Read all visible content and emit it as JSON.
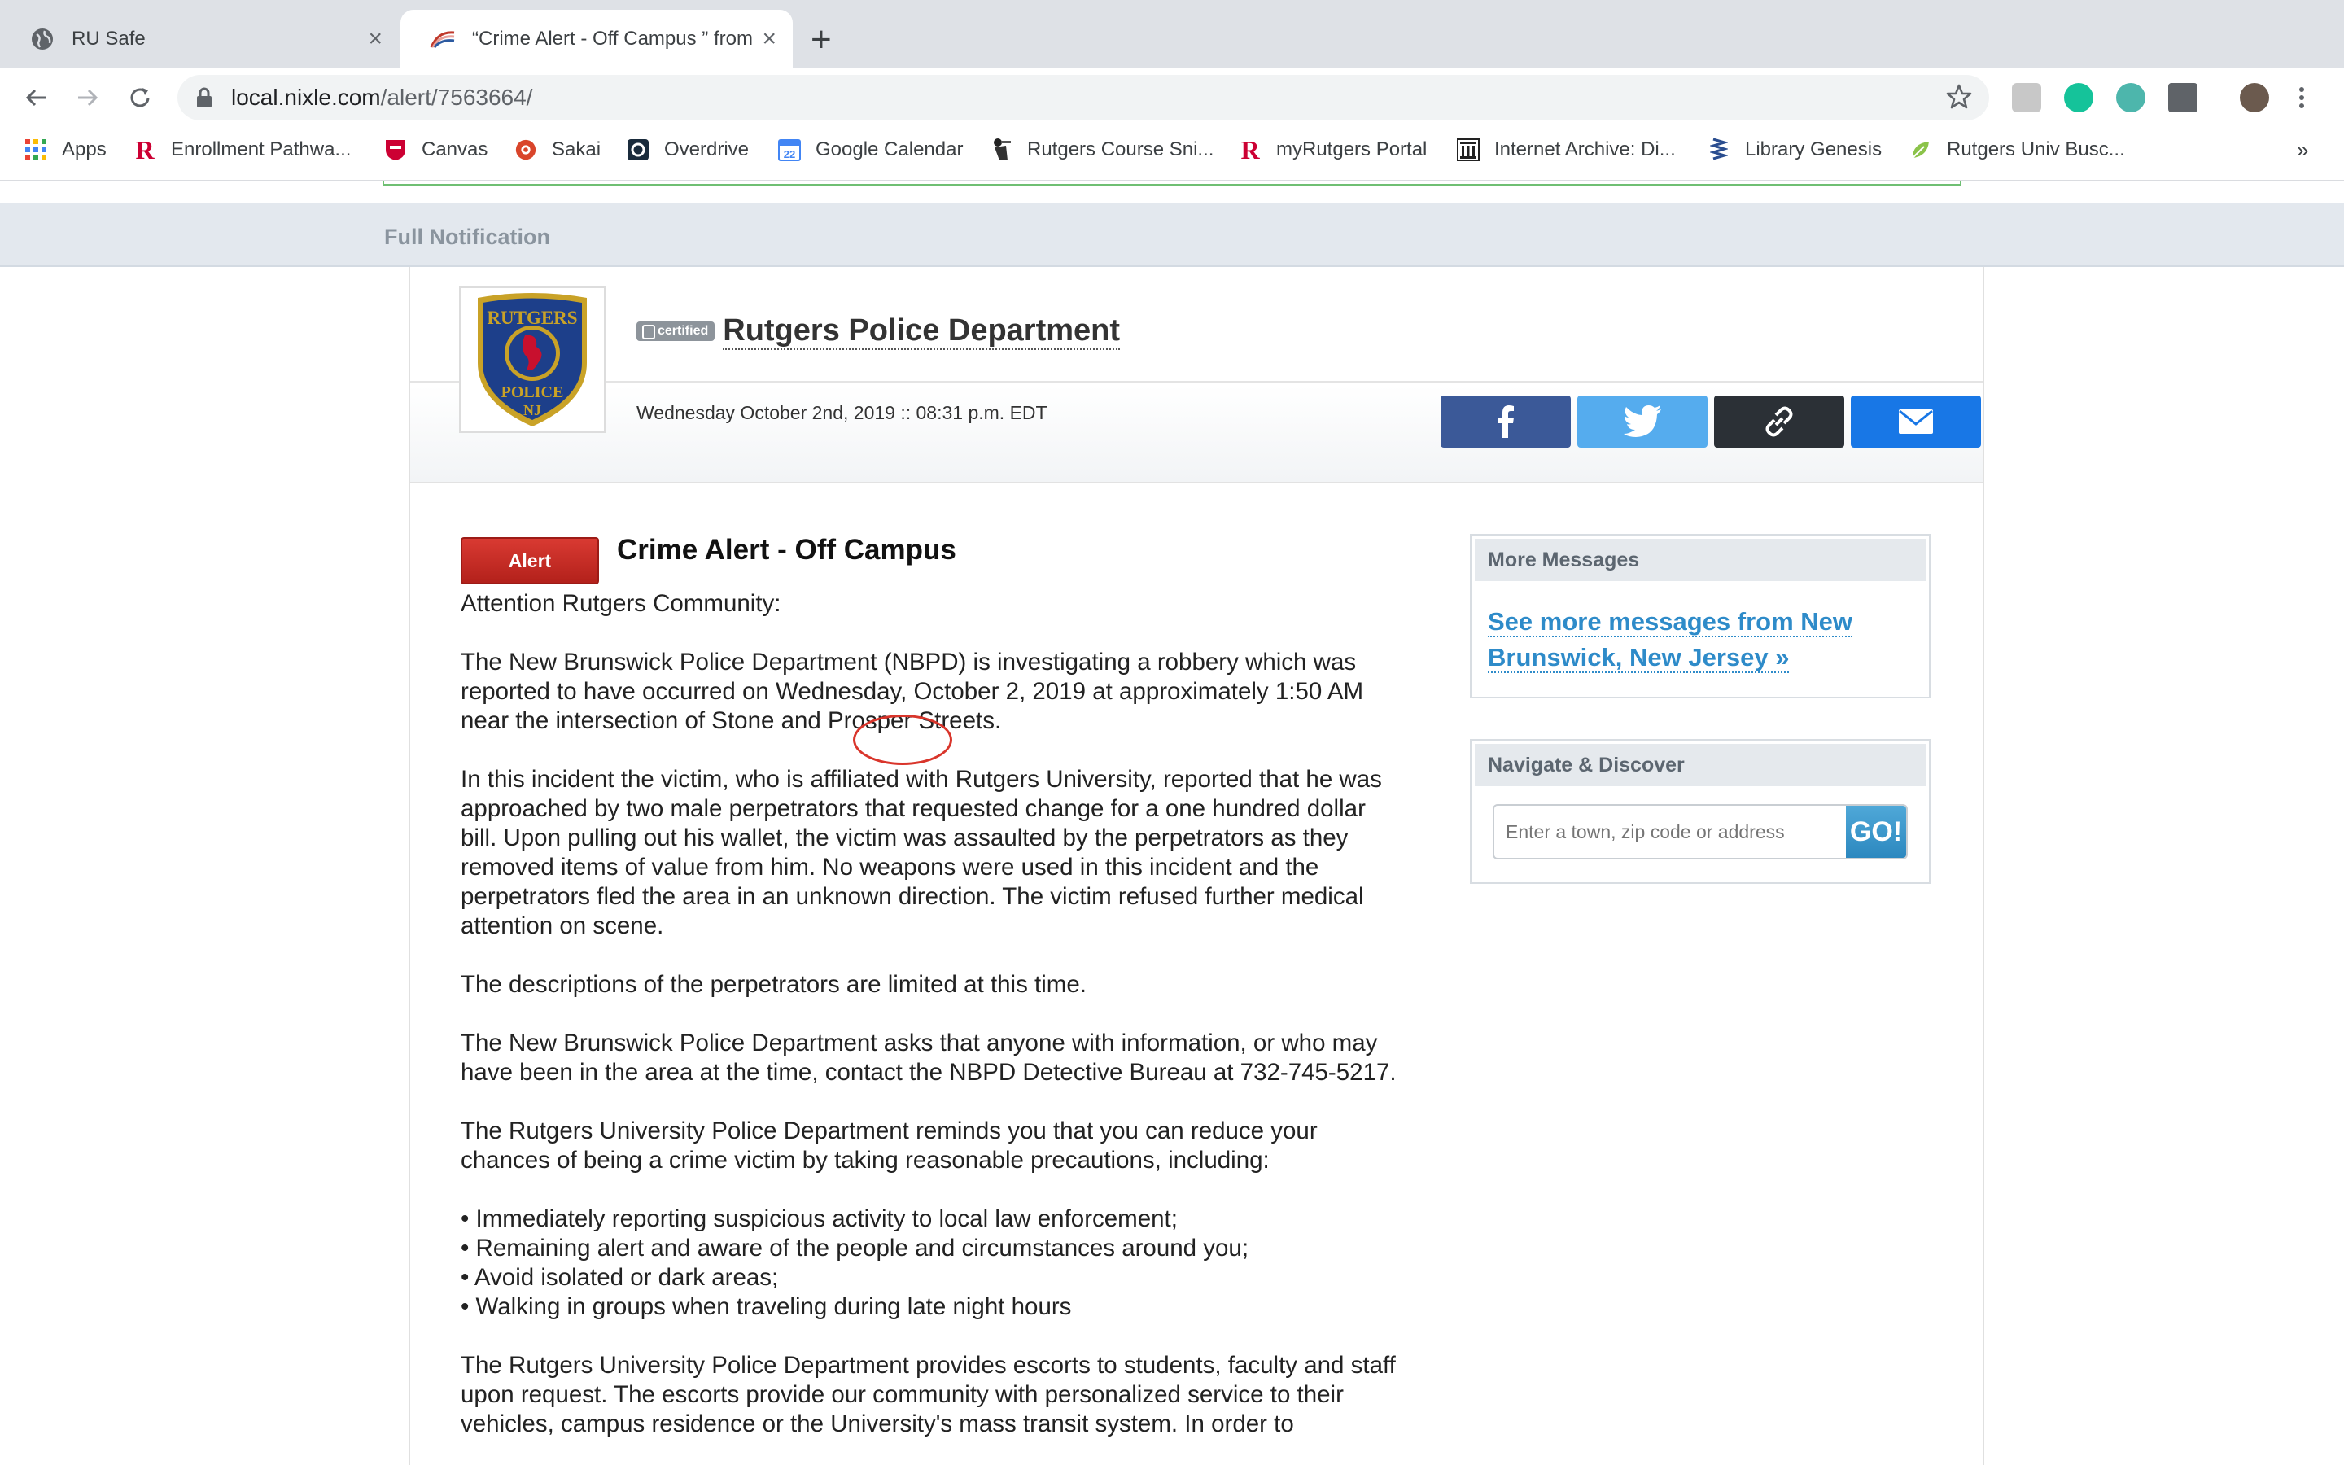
{
  "browser": {
    "tabs": [
      {
        "title": "RU Safe"
      },
      {
        "title": "“Crime Alert - Off Campus ” from"
      }
    ],
    "url_host": "local.nixle.com",
    "url_path": "/alert/7563664/",
    "bookmarks": [
      {
        "label": "Apps"
      },
      {
        "label": "Enrollment Pathwa..."
      },
      {
        "label": "Canvas"
      },
      {
        "label": "Sakai"
      },
      {
        "label": "Overdrive"
      },
      {
        "label": "Google Calendar"
      },
      {
        "label": "Rutgers Course Sni..."
      },
      {
        "label": "myRutgers Portal"
      },
      {
        "label": "Internet Archive: Di..."
      },
      {
        "label": "Library Genesis"
      },
      {
        "label": "Rutgers Univ Busc..."
      }
    ],
    "bookmarks_overflow": "»"
  },
  "page": {
    "section_label": "Full Notification",
    "logo_text_top": "RUTGERS",
    "logo_text_bottom": "POLICE",
    "logo_text_state": "NJ",
    "certified_label": "certified",
    "agency_name": "Rutgers Police Department",
    "datetime": "Wednesday October 2nd, 2019 :: 08:31 p.m. EDT",
    "badge": "Alert",
    "headline": "Crime Alert - Off Campus",
    "paragraphs": [
      "Attention Rutgers Community:",
      "The New Brunswick Police Department (NBPD) is investigating a robbery which was reported to have occurred on Wednesday, October 2, 2019 at approximately 1:50 AM near the intersection of Stone and Prosper Streets.",
      "In this incident the victim, who is affiliated with Rutgers University, reported that he was approached by two male perpetrators that requested change for a one hundred dollar bill. Upon pulling out his wallet, the victim was assaulted by the perpetrators as they removed items of value from him. No weapons were used in this incident and the perpetrators fled the area in an unknown direction. The victim refused further medical attention on scene.",
      "The descriptions of the perpetrators are limited at this time.",
      "The New Brunswick Police Department asks that anyone with information, or who may have been in the area at the time, contact the NBPD Detective Bureau at 732-745-5217.",
      "The Rutgers University Police Department reminds you that you can reduce your chances of being a crime victim by taking reasonable precautions, including:",
      "The Rutgers University Police Department provides escorts to students, faculty and staff upon request. The escorts provide our community with personalized service to their vehicles, campus residence or the University's mass transit system. In order to"
    ],
    "bullets": [
      "• Immediately reporting suspicious activity to local law enforcement;",
      "• Remaining alert and aware of the people and circumstances around you;",
      "• Avoid isolated or dark areas;",
      "• Walking in groups when traveling during late night hours"
    ],
    "sidebar": {
      "more_title": "More Messages",
      "more_link": "See more messages from New Brunswick, New Jersey »",
      "nav_title": "Navigate & Discover",
      "search_placeholder": "Enter a town, zip code or address",
      "go_label": "GO!"
    }
  },
  "colors": {
    "facebook": "#3b5998",
    "twitter": "#55acee",
    "link_share": "#2b3036",
    "email_share": "#1877e6",
    "alert_red": "#c8271f",
    "link_blue": "#2e8bc9",
    "annotation_circle": "#d9352b"
  }
}
